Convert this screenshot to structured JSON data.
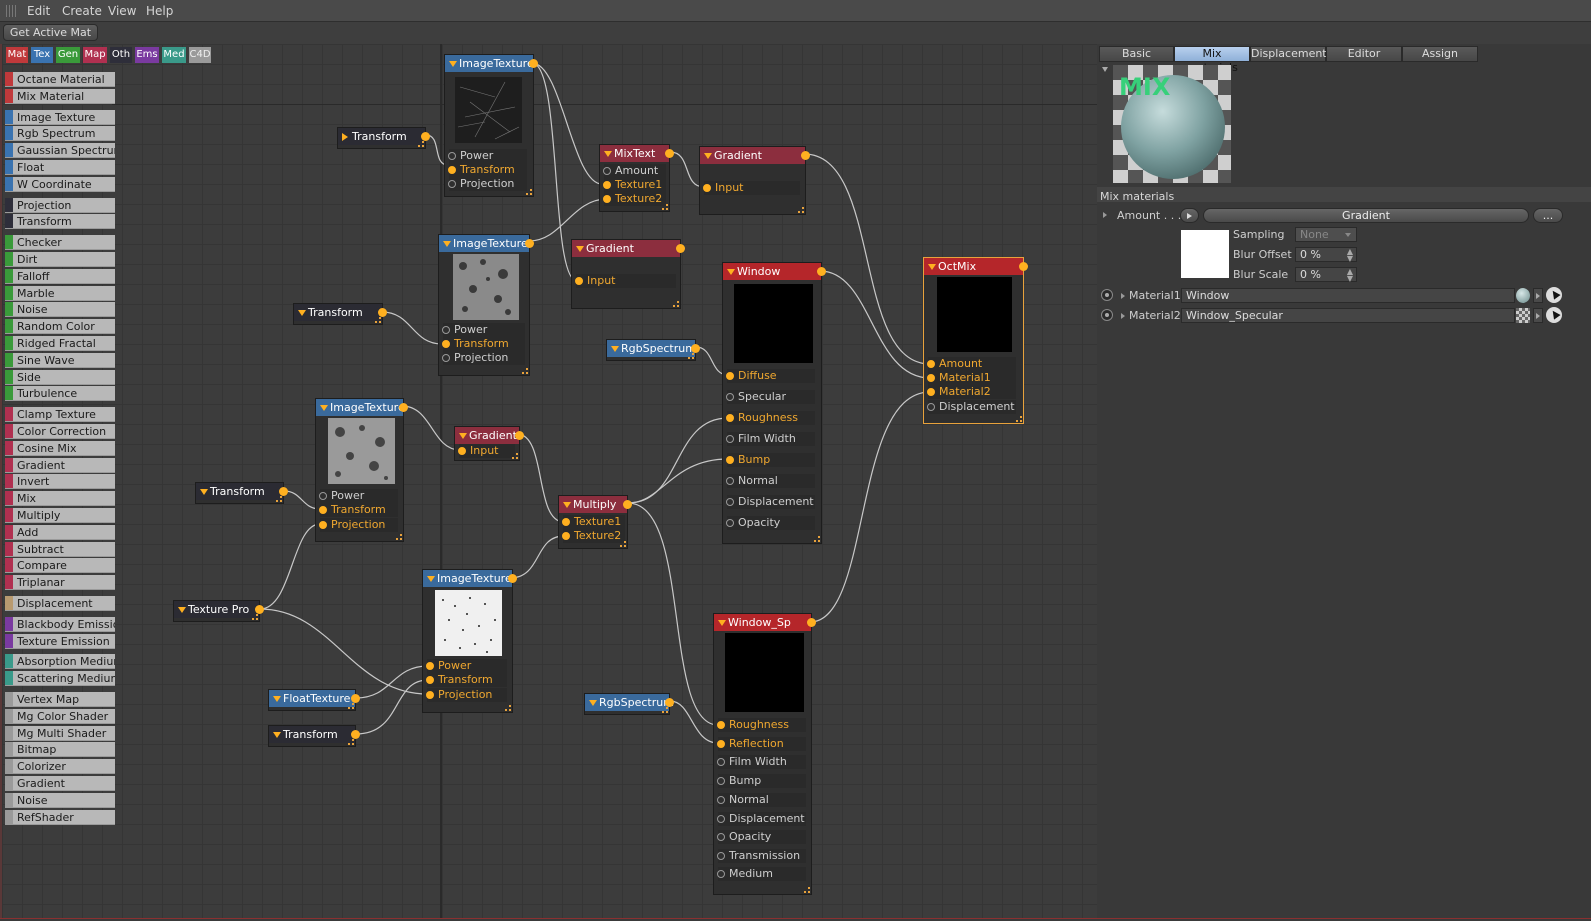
{
  "menu": {
    "items": [
      "Edit",
      "Create",
      "View",
      "Help"
    ]
  },
  "toolbar": {
    "get_active_label": "Get Active Mat"
  },
  "categories": [
    {
      "label": "Mat",
      "color": "#c0393b"
    },
    {
      "label": "Tex",
      "color": "#3a73b0"
    },
    {
      "label": "Gen",
      "color": "#3a9a3a"
    },
    {
      "label": "Map",
      "color": "#b03050"
    },
    {
      "label": "Oth",
      "color": "#2e2e3a"
    },
    {
      "label": "Ems",
      "color": "#7a3aa0"
    },
    {
      "label": "Med",
      "color": "#3a9a8a"
    },
    {
      "label": "C4D",
      "color": "#9a9a9a"
    }
  ],
  "palette": {
    "groups": [
      {
        "color": "#c0393b",
        "items": [
          "Octane Material",
          "Mix Material"
        ]
      },
      {
        "color": "#3a73b0",
        "items": [
          "Image Texture",
          "Rgb Spectrum",
          "Gaussian Spectrum",
          "Float",
          "W Coordinate"
        ]
      },
      {
        "color": "#2e2e3a",
        "items": [
          "Projection",
          "Transform"
        ]
      },
      {
        "color": "#3a9a3a",
        "items": [
          "Checker",
          "Dirt",
          "Falloff",
          "Marble",
          "Noise",
          "Random Color",
          "Ridged Fractal",
          "Sine Wave",
          "Side",
          "Turbulence"
        ]
      },
      {
        "color": "#b03050",
        "items": [
          "Clamp Texture",
          "Color Correction",
          "Cosine Mix",
          "Gradient",
          "Invert",
          "Mix",
          "Multiply",
          "Add",
          "Subtract",
          "Compare",
          "Triplanar"
        ]
      },
      {
        "color": "#b89a70",
        "items": [
          "Displacement"
        ]
      },
      {
        "color": "#7a3aa0",
        "items": [
          "Blackbody Emission",
          "Texture Emission"
        ]
      },
      {
        "color": "#3a9a8a",
        "items": [
          "Absorption Medium",
          "Scattering Medium"
        ]
      },
      {
        "color": "#9a9a9a",
        "items": [
          "Vertex Map",
          "Mg Color Shader",
          "Mg Multi Shader",
          "Bitmap",
          "Colorizer",
          "Gradient",
          "Noise",
          "RefShader"
        ]
      }
    ]
  },
  "nodes": {
    "imgtex1": {
      "title": "ImageTexture",
      "inputs": [
        "Power",
        "Transform",
        "Projection"
      ]
    },
    "imgtex2": {
      "title": "ImageTexture",
      "inputs": [
        "Power",
        "Transform",
        "Projection"
      ]
    },
    "imgtex3": {
      "title": "ImageTexture",
      "inputs": [
        "Power",
        "Transform",
        "Projection"
      ]
    },
    "imgtex4": {
      "title": "ImageTexture",
      "inputs": [
        "Power",
        "Transform",
        "Projection"
      ]
    },
    "transform1": {
      "title": "Transform"
    },
    "transform2": {
      "title": "Transform"
    },
    "transform3": {
      "title": "Transform"
    },
    "transform4": {
      "title": "Transform"
    },
    "mixtext": {
      "title": "MixText",
      "inputs": [
        "Amount",
        "Texture1",
        "Texture2"
      ]
    },
    "gradient1": {
      "title": "Gradient",
      "inputs": [
        "Input"
      ]
    },
    "gradient2": {
      "title": "Gradient",
      "inputs": [
        "Input"
      ]
    },
    "gradient3": {
      "title": "Gradient",
      "inputs": [
        "Input"
      ]
    },
    "multiply": {
      "title": "Multiply",
      "inputs": [
        "Texture1",
        "Texture2"
      ]
    },
    "texpro": {
      "title": "Texture Pro"
    },
    "floattex": {
      "title": "FloatTexture"
    },
    "rgb1": {
      "title": "RgbSpectrum"
    },
    "rgb2": {
      "title": "RgbSpectrum"
    },
    "window": {
      "title": "Window",
      "inputs": [
        "Diffuse",
        "Specular",
        "Roughness",
        "Film Width",
        "Bump",
        "Normal",
        "Displacement",
        "Opacity"
      ]
    },
    "windowsp": {
      "title": "Window_Sp",
      "inputs": [
        "Roughness",
        "Reflection",
        "Film Width",
        "Bump",
        "Normal",
        "Displacement",
        "Opacity",
        "Transmission",
        "Medium"
      ]
    },
    "octmix": {
      "title": "OctMix",
      "inputs": [
        "Amount",
        "Material1",
        "Material2",
        "Displacement"
      ]
    }
  },
  "panel": {
    "tabs": [
      "Basic",
      "Mix materials",
      "Displacement",
      "Editor",
      "Assign"
    ],
    "active_tab": "Mix materials",
    "preview_text": "MIX",
    "section_title": "Mix materials",
    "amount_label": "Amount . . .",
    "amount_value": "Gradient",
    "more_label": "...",
    "sampling_label": "Sampling",
    "sampling_value": "None",
    "blur_offset_label": "Blur Offset",
    "blur_offset_value": "0 %",
    "blur_scale_label": "Blur Scale",
    "blur_scale_value": "0 %",
    "material1_label": "Material1",
    "material1_value": "Window",
    "material2_label": "Material2",
    "material2_value": "Window_Specular"
  },
  "colors": {
    "accent": "#ffb020",
    "tex_header": "#3a6a9c",
    "ops_header": "#8c2e3e",
    "mat_header": "#b5262a",
    "tab_active": "#a8c4e8"
  }
}
